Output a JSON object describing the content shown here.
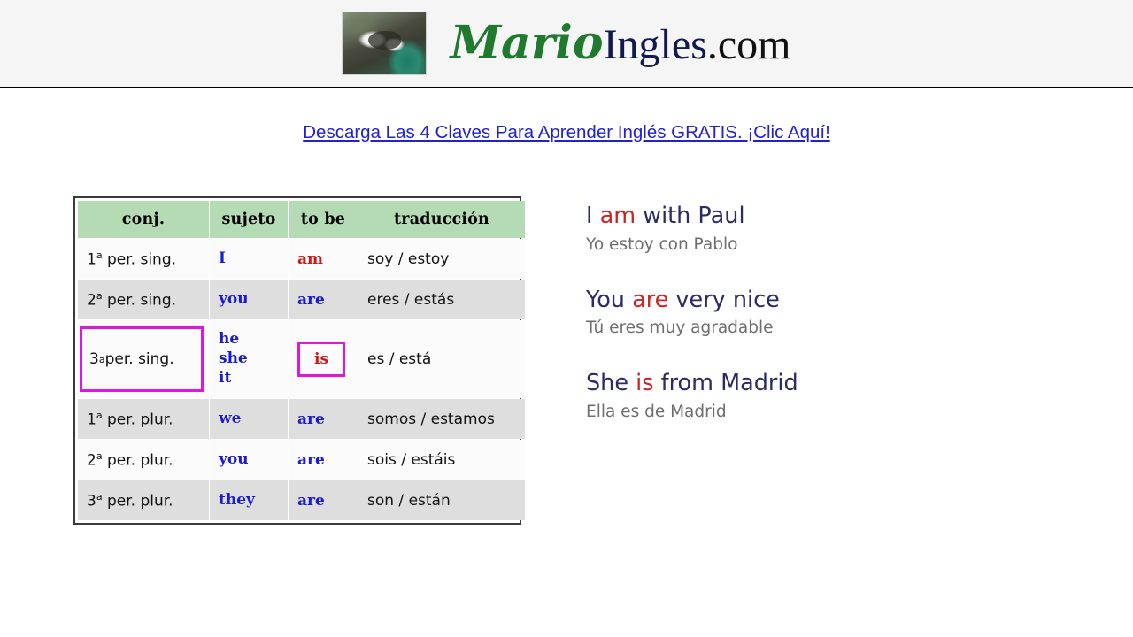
{
  "site": {
    "logo_photo": "mario-photo-thumbnail",
    "brand_part1": "Mario",
    "brand_part2": "Ingles",
    "brand_part3": ".com"
  },
  "promo": {
    "link_text": "Descarga Las 4 Claves Para Aprender Inglés GRATIS. ¡Clic Aquí!",
    "link_color": "#2222cc"
  },
  "table": {
    "headers": [
      "conj.",
      "sujeto",
      "to be",
      "traducción"
    ],
    "header_bg": "#b5dbb4",
    "highlight_color": "#e313e3",
    "rows": [
      {
        "conj_num": "1",
        "conj_ord": "a",
        "conj_rest": " per. sing.",
        "subject": "I",
        "tobe": "am",
        "tobe_color": "red",
        "translation": "soy / estoy",
        "highlighted": false
      },
      {
        "conj_num": "2",
        "conj_ord": "a",
        "conj_rest": " per. sing.",
        "subject": "you",
        "tobe": "are",
        "tobe_color": "blue",
        "translation": "eres / estás",
        "highlighted": false
      },
      {
        "conj_num": "3",
        "conj_ord": "a",
        "conj_rest": " per. sing.",
        "subject": "he\nshe\nit",
        "subject_line1": "he",
        "subject_line2": "she",
        "subject_line3": "it",
        "tobe": "is",
        "tobe_color": "red",
        "translation": "es / está",
        "highlighted": true
      },
      {
        "conj_num": "1",
        "conj_ord": "a",
        "conj_rest": " per. plur.",
        "subject": "we",
        "tobe": "are",
        "tobe_color": "blue",
        "translation": "somos / estamos",
        "highlighted": false
      },
      {
        "conj_num": "2",
        "conj_ord": "a",
        "conj_rest": " per. plur.",
        "subject": "you",
        "tobe": "are",
        "tobe_color": "blue",
        "translation": "sois / estáis",
        "highlighted": false
      },
      {
        "conj_num": "3",
        "conj_ord": "a",
        "conj_rest": " per. plur.",
        "subject": "they",
        "tobe": "are",
        "tobe_color": "blue",
        "translation": "son / están",
        "highlighted": false
      }
    ]
  },
  "examples": [
    {
      "en_before": "I ",
      "en_verb": "am",
      "en_after": " with Paul",
      "es": "Yo estoy con Pablo"
    },
    {
      "en_before": "You ",
      "en_verb": "are",
      "en_after": " very nice",
      "es": "Tú eres muy agradable"
    },
    {
      "en_before": "She ",
      "en_verb": "is",
      "en_after": " from Madrid",
      "es": "Ella es de Madrid"
    }
  ]
}
